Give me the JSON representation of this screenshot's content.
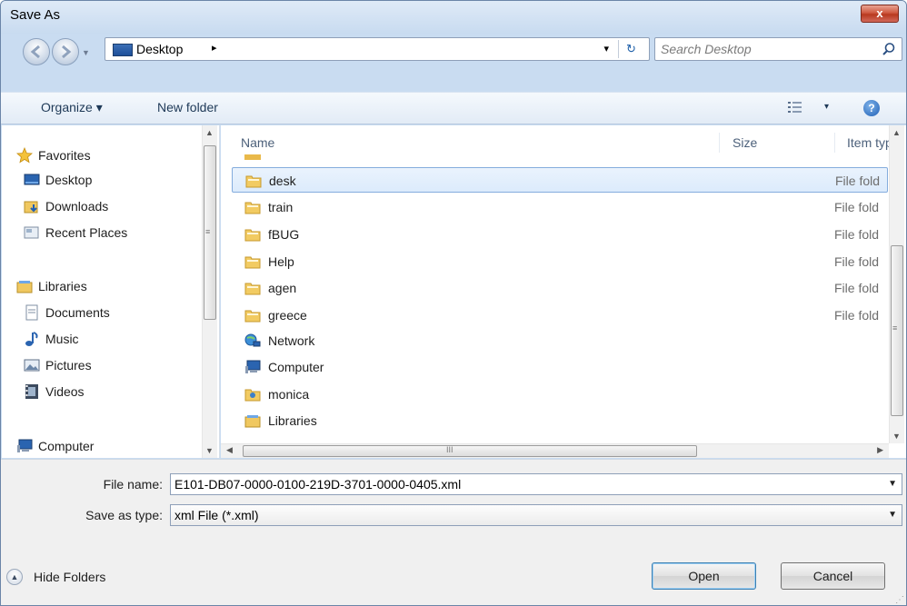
{
  "window": {
    "title": "Save As",
    "close_label": "x"
  },
  "address": {
    "location": "Desktop",
    "breadcrumb_arrow": "▸",
    "dropdown_glyph": "▾",
    "refresh_glyph": "↻"
  },
  "search": {
    "placeholder": "Search Desktop"
  },
  "toolbar": {
    "organize_label": "Organize ▾",
    "new_folder_label": "New folder",
    "view_dd": "▾",
    "help_glyph": "?"
  },
  "nav_pane": {
    "items": [
      {
        "label": "Favorites",
        "icon": "star-icon"
      },
      {
        "label": "Desktop",
        "icon": "desktop-icon"
      },
      {
        "label": "Downloads",
        "icon": "downloads-icon"
      },
      {
        "label": "Recent Places",
        "icon": "recent-places-icon"
      },
      {
        "label": "Libraries",
        "icon": "libraries-icon"
      },
      {
        "label": "Documents",
        "icon": "documents-icon"
      },
      {
        "label": "Music",
        "icon": "music-icon"
      },
      {
        "label": "Pictures",
        "icon": "pictures-icon"
      },
      {
        "label": "Videos",
        "icon": "videos-icon"
      },
      {
        "label": "Computer",
        "icon": "computer-icon"
      }
    ]
  },
  "file_list": {
    "columns": [
      "Name",
      "Size",
      "Item typ"
    ],
    "rows": [
      {
        "name": "desk",
        "type": "File fold",
        "icon": "folder-icon",
        "selected": true
      },
      {
        "name": "train",
        "type": "File fold",
        "icon": "folder-icon"
      },
      {
        "name": "fBUG",
        "type": "File fold",
        "icon": "folder-icon"
      },
      {
        "name": "Help",
        "type": "File fold",
        "icon": "folder-icon"
      },
      {
        "name": "agen",
        "type": "File fold",
        "icon": "folder-icon"
      },
      {
        "name": "greece",
        "type": "File fold",
        "icon": "folder-icon"
      },
      {
        "name": "Network",
        "type": "",
        "icon": "network-icon"
      },
      {
        "name": "Computer",
        "type": "",
        "icon": "computer-icon"
      },
      {
        "name": "monica",
        "type": "",
        "icon": "user-folder-icon"
      },
      {
        "name": "Libraries",
        "type": "",
        "icon": "libraries-icon"
      }
    ]
  },
  "form": {
    "file_name_label": "File name:",
    "file_name_value": "E101-DB07-0000-0100-219D-3701-0000-0405.xml",
    "save_type_label": "Save as type:",
    "save_type_value": "xml File (*.xml)",
    "hide_folders_label": "Hide Folders",
    "open_label": "Open",
    "cancel_label": "Cancel"
  },
  "colors": {
    "frame": "#c9dcf1",
    "selection": "#dcebfc",
    "accent": "#1f5fb5"
  }
}
